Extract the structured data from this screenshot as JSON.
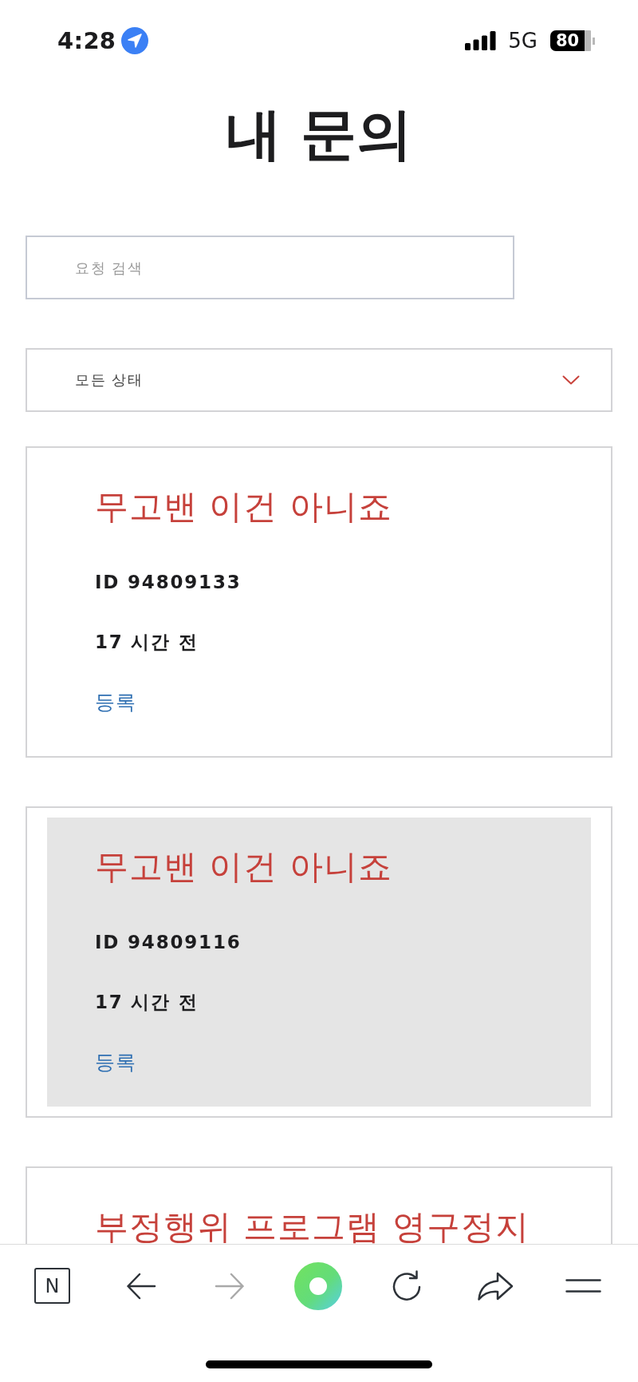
{
  "status_bar": {
    "time": "4:28",
    "network": "5G",
    "battery": "80"
  },
  "page_title": "내 문의",
  "search": {
    "placeholder": "요청 검색"
  },
  "status_filter": {
    "value": "모든 상태"
  },
  "requests": [
    {
      "title": "무고밴 이건 아니죠",
      "id": "ID 94809133",
      "time": "17 시간 전",
      "status": "등록",
      "selected": false
    },
    {
      "title": "무고밴 이건 아니죠",
      "id": "ID 94809116",
      "time": "17 시간 전",
      "status": "등록",
      "selected": true
    },
    {
      "title": "부정행위 프로그램 영구정지",
      "selected": false
    }
  ],
  "browser_toolbar": {
    "items": [
      {
        "kind": "logo",
        "label": "N",
        "disabled": false
      },
      {
        "kind": "back",
        "disabled": false
      },
      {
        "kind": "forward",
        "disabled": true
      },
      {
        "kind": "circle",
        "disabled": false
      },
      {
        "kind": "reload",
        "disabled": false
      },
      {
        "kind": "share",
        "disabled": false
      },
      {
        "kind": "menu",
        "disabled": false
      }
    ]
  }
}
